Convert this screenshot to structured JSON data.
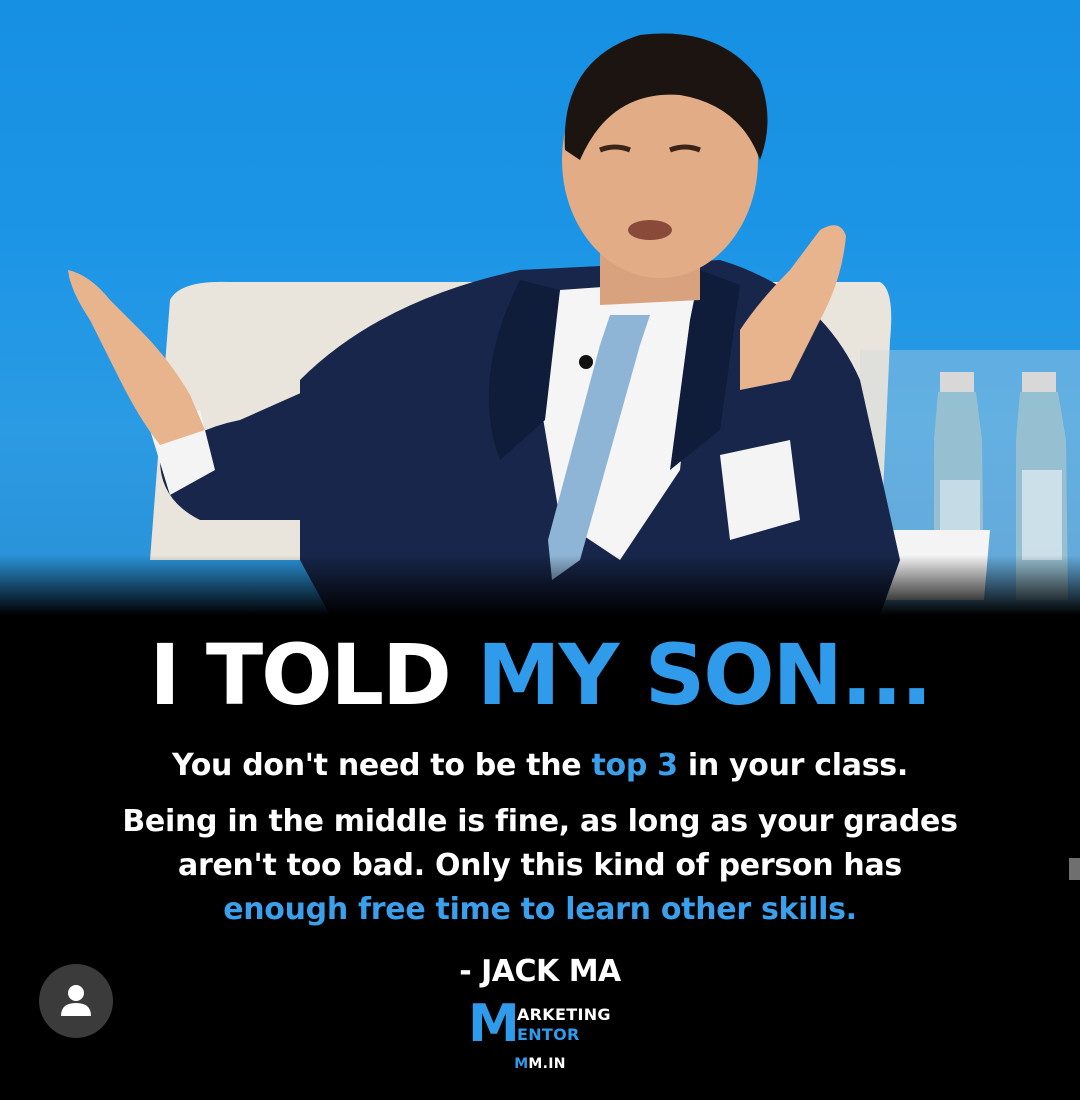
{
  "headline": {
    "part1": "I TOLD ",
    "part2": "MY SON..."
  },
  "quote": {
    "line1_a": "You don't need to be the ",
    "line1_b": "top 3",
    "line1_c": " in your class.",
    "line2": "Being in the middle is fine, as long as your grades",
    "line3": "aren't too bad. Only this kind of person has",
    "line4": "enough free time to learn other skills."
  },
  "author": "- JACK MA",
  "brand": {
    "letter": "M",
    "word1": "ARKETING",
    "word2": "ENTOR",
    "site_a": "M",
    "site_b": "M.IN"
  },
  "colors": {
    "accent": "#2f9bea",
    "background": "#000000",
    "sky": "#1d95e6"
  },
  "icons": {
    "avatar": "person-icon"
  }
}
